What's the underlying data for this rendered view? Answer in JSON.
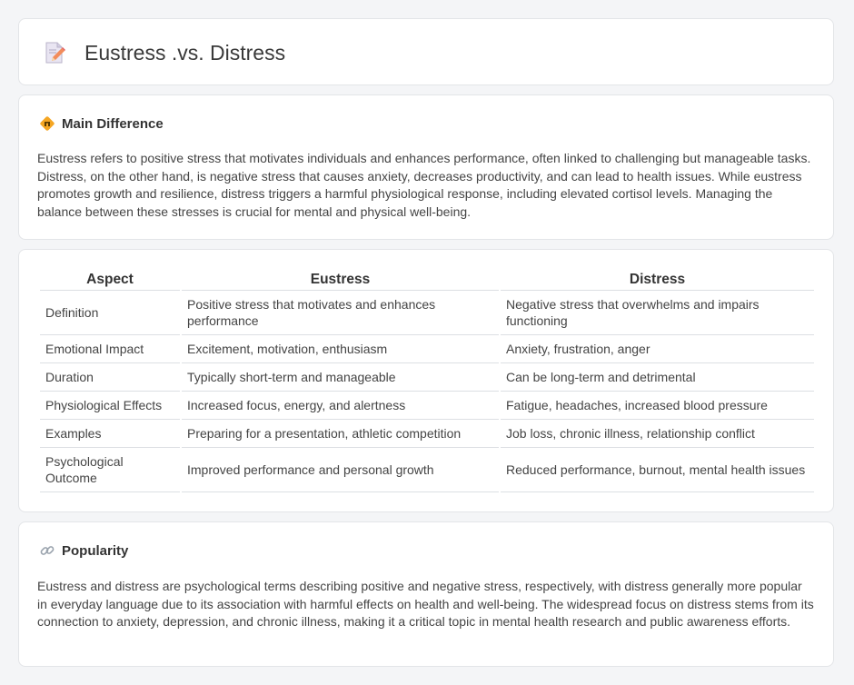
{
  "header": {
    "title": "Eustress .vs. Distress",
    "icon": "document-edit-icon"
  },
  "main_difference": {
    "title": "Main Difference",
    "icon": "diamond-sign-icon",
    "text": "Eustress refers to positive stress that motivates individuals and enhances performance, often linked to challenging but manageable tasks. Distress, on the other hand, is negative stress that causes anxiety, decreases productivity, and can lead to health issues. While eustress promotes growth and resilience, distress triggers a harmful physiological response, including elevated cortisol levels. Managing the balance between these stresses is crucial for mental and physical well-being."
  },
  "comparison": {
    "headers": [
      "Aspect",
      "Eustress",
      "Distress"
    ],
    "rows": [
      [
        "Definition",
        "Positive stress that motivates and enhances performance",
        "Negative stress that overwhelms and impairs functioning"
      ],
      [
        "Emotional Impact",
        "Excitement, motivation, enthusiasm",
        "Anxiety, frustration, anger"
      ],
      [
        "Duration",
        "Typically short-term and manageable",
        "Can be long-term and detrimental"
      ],
      [
        "Physiological Effects",
        "Increased focus, energy, and alertness",
        "Fatigue, headaches, increased blood pressure"
      ],
      [
        "Examples",
        "Preparing for a presentation, athletic competition",
        "Job loss, chronic illness, relationship conflict"
      ],
      [
        "Psychological Outcome",
        "Improved performance and personal growth",
        "Reduced performance, burnout, mental health issues"
      ]
    ]
  },
  "popularity": {
    "title": "Popularity",
    "icon": "link-icon",
    "text": "Eustress and distress are psychological terms describing positive and negative stress, respectively, with distress generally more popular in everyday language due to its association with harmful effects on health and well-being. The widespread focus on distress stems from its connection to anxiety, depression, and chronic illness, making it a critical topic in mental health research and public awareness efforts."
  },
  "colors": {
    "page_bg": "#f4f5f7",
    "card_bg": "#ffffff",
    "accent_orange": "#f5a623",
    "doc_icon_pink": "#f06a6a"
  }
}
